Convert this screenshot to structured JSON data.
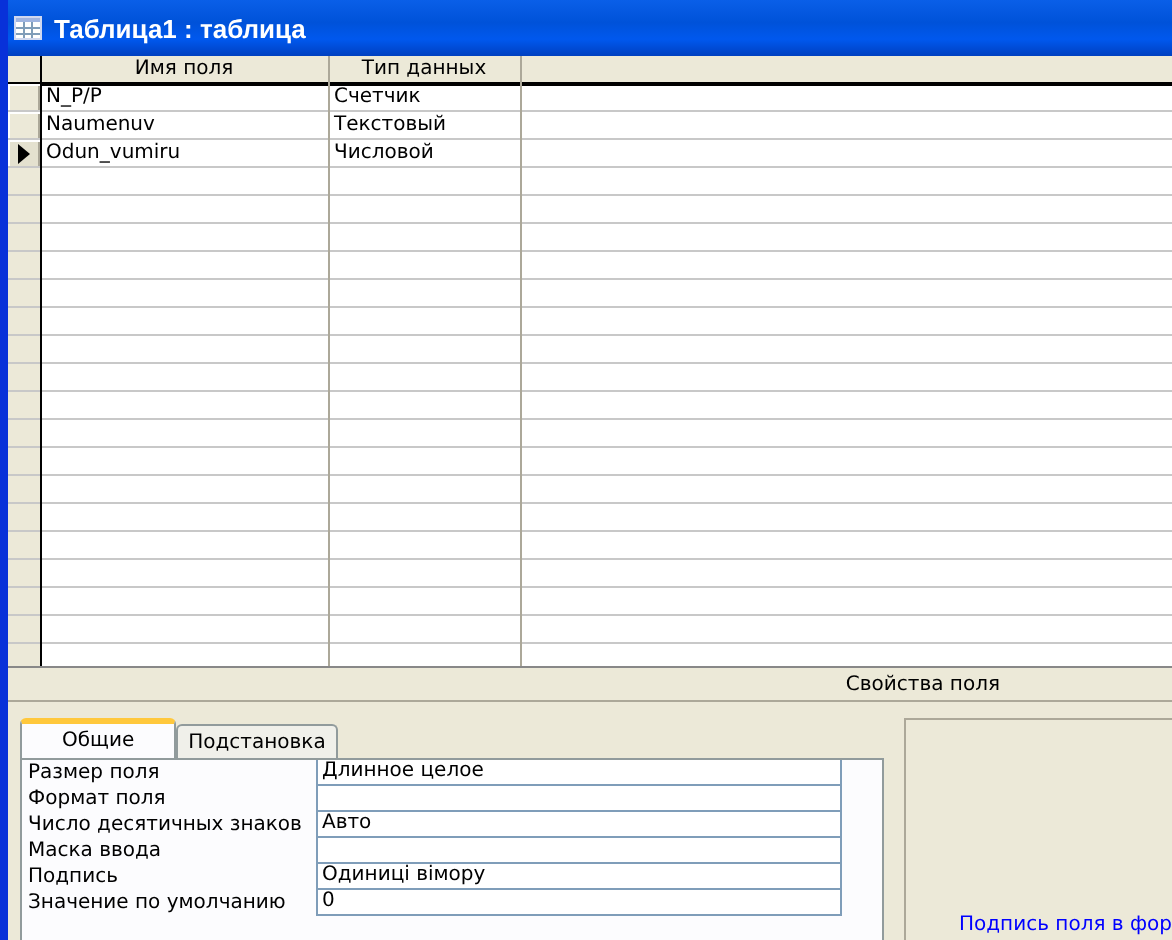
{
  "window": {
    "title": "Таблица1 : таблица"
  },
  "table": {
    "columns": [
      "Имя поля",
      "Тип данных"
    ],
    "rows": [
      {
        "name": "N_P/P",
        "type": "Счетчик",
        "selected": false
      },
      {
        "name": "Naumenuv",
        "type": "Текстовый",
        "selected": false
      },
      {
        "name": "Odun_vumiru",
        "type": "Числовой",
        "selected": true
      }
    ]
  },
  "properties_caption": "Свойства поля",
  "tabs": [
    {
      "label": "Общие",
      "selected": true
    },
    {
      "label": "Подстановка",
      "selected": false
    }
  ],
  "properties": [
    {
      "label": "Размер поля",
      "value": "Длинное целое"
    },
    {
      "label": "Формат поля"
    },
    {
      "label": "Число десятичных знаков",
      "value": "Авто"
    },
    {
      "label": "Маска ввода"
    },
    {
      "label": "Подпись",
      "value": "Одиниці вімору"
    },
    {
      "label": "Значение по умолчанию",
      "value": "0"
    }
  ],
  "help_text": "Подпись поля в фор"
}
